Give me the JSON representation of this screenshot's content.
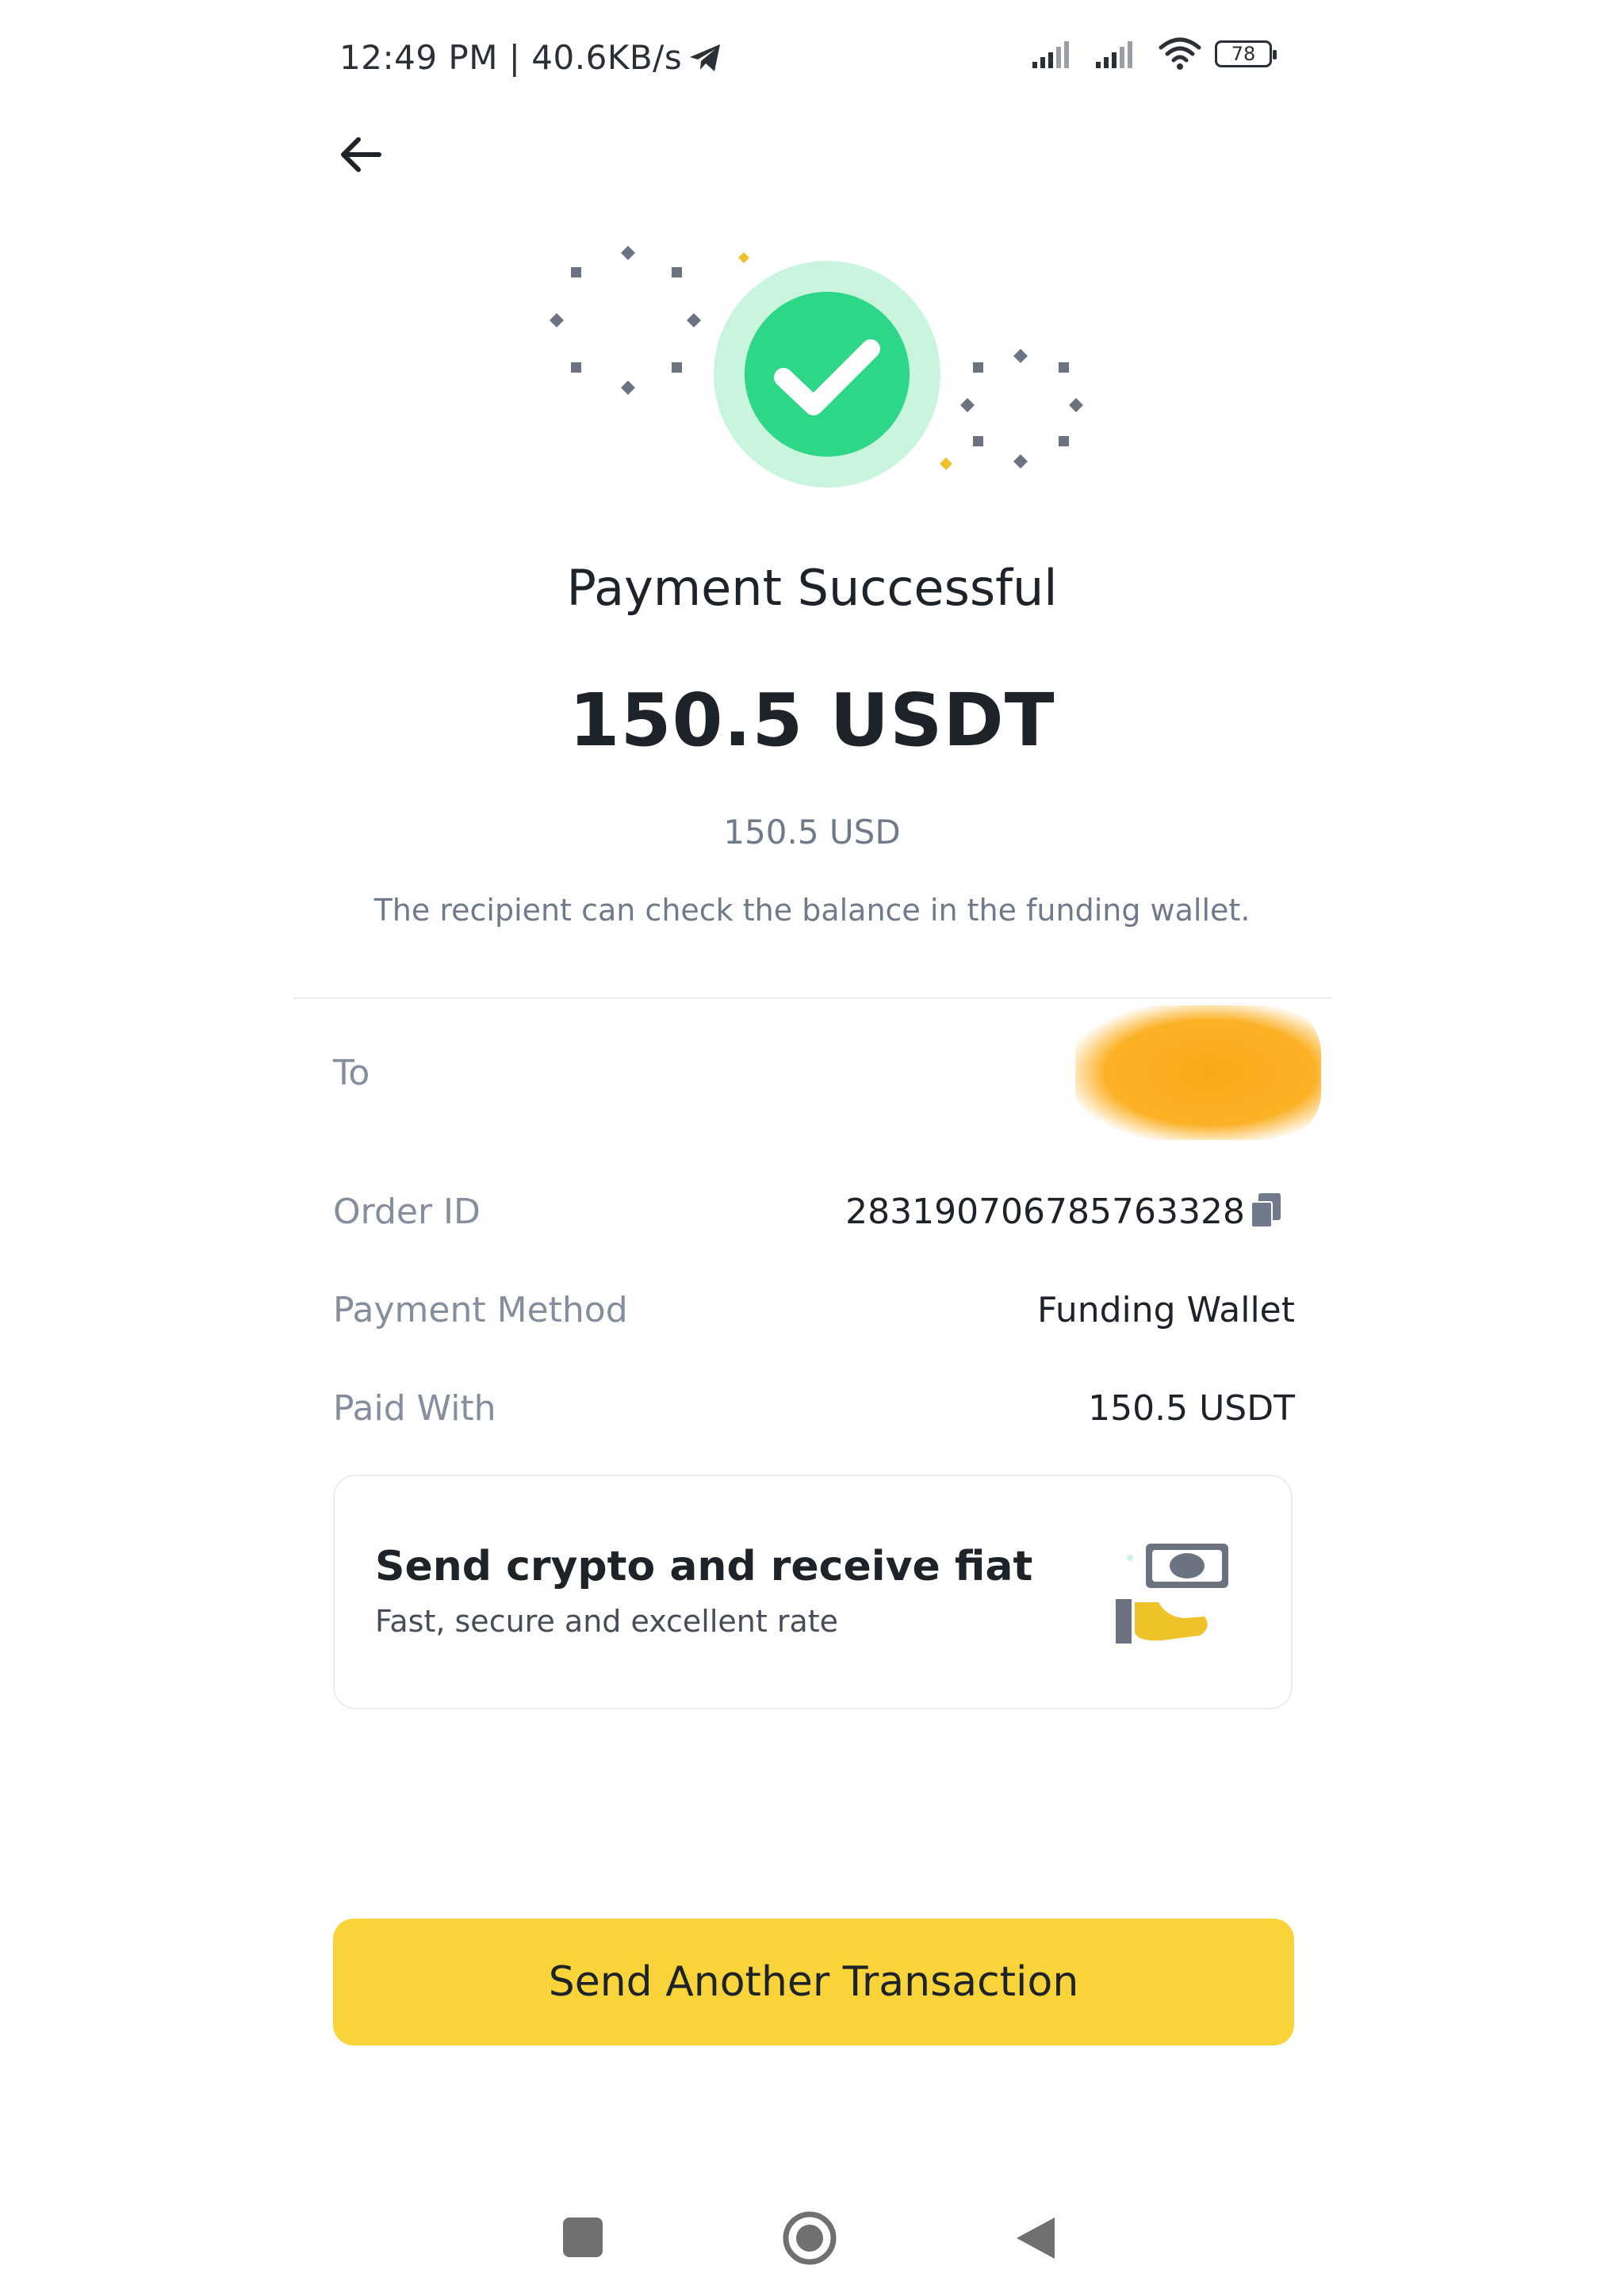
{
  "status_bar": {
    "time_speed": "12:49 PM | 40.6KB/s",
    "battery": "78",
    "icons": [
      "telegram-icon",
      "signal-icon",
      "signal-icon",
      "wifi-icon",
      "battery-icon"
    ]
  },
  "header": {
    "back_icon": "arrow-left-icon"
  },
  "result": {
    "icon": "success-check-icon",
    "title": "Payment Successful",
    "amount": "150.5 USDT",
    "fiat_amount": "150.5 USD",
    "note": "The recipient can check the balance in the funding wallet."
  },
  "details": [
    {
      "label": "To",
      "value": ""
    },
    {
      "label": "Order ID",
      "value": "283190706785763328"
    },
    {
      "label": "Payment Method",
      "value": "Funding Wallet"
    },
    {
      "label": "Paid With",
      "value": "150.5 USDT"
    }
  ],
  "promo": {
    "title": "Send crypto and receive fiat",
    "subtitle": "Fast, secure and excellent rate",
    "illustration": "cash-hand-illustration"
  },
  "primary_button": {
    "label": "Send Another Transaction"
  },
  "colors": {
    "brand_yellow": "#f8d33a",
    "success_green": "#2ed687",
    "success_ring": "#c9f5df",
    "text_primary": "#1e2329",
    "text_secondary": "#848e9c"
  },
  "system_nav": [
    "recents-square-icon",
    "home-circle-icon",
    "back-triangle-icon"
  ]
}
